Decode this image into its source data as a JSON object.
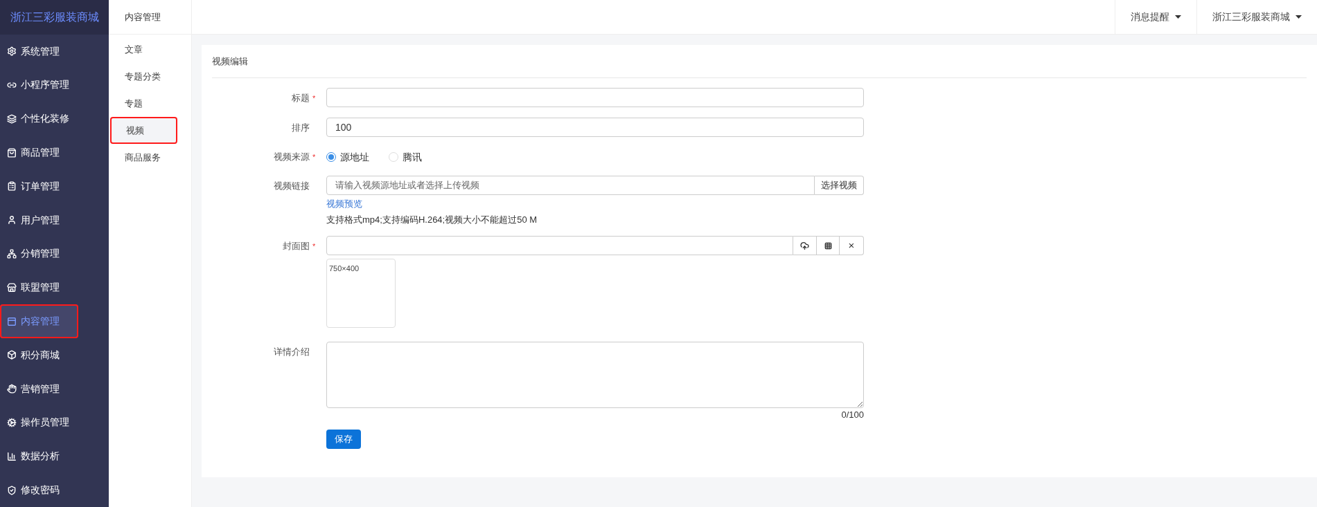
{
  "brand": "浙江三彩服装商城",
  "sidebar": {
    "items": [
      {
        "label": "系统管理",
        "selected": false,
        "highlighted": false
      },
      {
        "label": "小程序管理",
        "selected": false,
        "highlighted": false
      },
      {
        "label": "个性化装修",
        "selected": false,
        "highlighted": false
      },
      {
        "label": "商品管理",
        "selected": false,
        "highlighted": false
      },
      {
        "label": "订单管理",
        "selected": false,
        "highlighted": false
      },
      {
        "label": "用户管理",
        "selected": false,
        "highlighted": false
      },
      {
        "label": "分销管理",
        "selected": false,
        "highlighted": false
      },
      {
        "label": "联盟管理",
        "selected": false,
        "highlighted": false
      },
      {
        "label": "内容管理",
        "selected": true,
        "highlighted": true
      },
      {
        "label": "积分商城",
        "selected": false,
        "highlighted": false
      },
      {
        "label": "营销管理",
        "selected": false,
        "highlighted": false
      },
      {
        "label": "操作员管理",
        "selected": false,
        "highlighted": false
      },
      {
        "label": "数据分析",
        "selected": false,
        "highlighted": false
      },
      {
        "label": "修改密码",
        "selected": false,
        "highlighted": false
      }
    ]
  },
  "subnav": {
    "title": "内容管理",
    "items": [
      {
        "label": "文章",
        "selected": false,
        "highlighted": false
      },
      {
        "label": "专题分类",
        "selected": false,
        "highlighted": false
      },
      {
        "label": "专题",
        "selected": false,
        "highlighted": false
      },
      {
        "label": "视频",
        "selected": true,
        "highlighted": true
      },
      {
        "label": "商品服务",
        "selected": false,
        "highlighted": false
      }
    ]
  },
  "header": {
    "menus": [
      "消息提醒",
      "浙江三彩服装商城"
    ]
  },
  "panel": {
    "title": "视频编辑",
    "title_field": {
      "label": "标题",
      "required_mark": "*"
    },
    "sort_field": {
      "label": "排序",
      "value": "100"
    },
    "source": {
      "label": "视频来源",
      "required_mark": "*",
      "options": [
        {
          "label": "源地址",
          "selected": true
        },
        {
          "label": "腾讯",
          "selected": false
        }
      ]
    },
    "link": {
      "label": "视频链接",
      "placeholder": "请输入视频源地址或者选择上传视频",
      "button": "选择视频",
      "preview_link": "视频预览",
      "hint": "支持格式mp4;支持编码H.264;视频大小不能超过50 M"
    },
    "cover": {
      "label": "封面图",
      "required_mark": "*",
      "size_hint": "750×400",
      "clear": "×"
    },
    "detail": {
      "label": "详情介绍",
      "counter": "0/100"
    },
    "save": "保存"
  }
}
